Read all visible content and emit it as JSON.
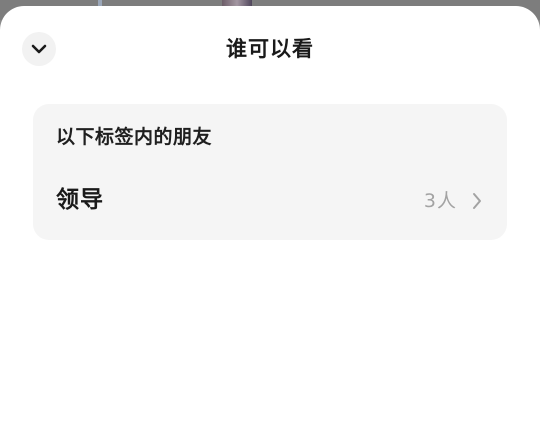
{
  "sheet": {
    "title": "谁可以看",
    "collapse_icon": "chevron-down-icon"
  },
  "visibility_card": {
    "heading": "以下标签内的朋友",
    "tag": {
      "name": "领导",
      "count": "3人",
      "arrow_icon": "chevron-right-icon"
    }
  },
  "colors": {
    "sheet_background": "#ffffff",
    "card_background": "#f5f5f5",
    "primary_text": "#1a1a1a",
    "secondary_text": "#a3a3a3"
  }
}
